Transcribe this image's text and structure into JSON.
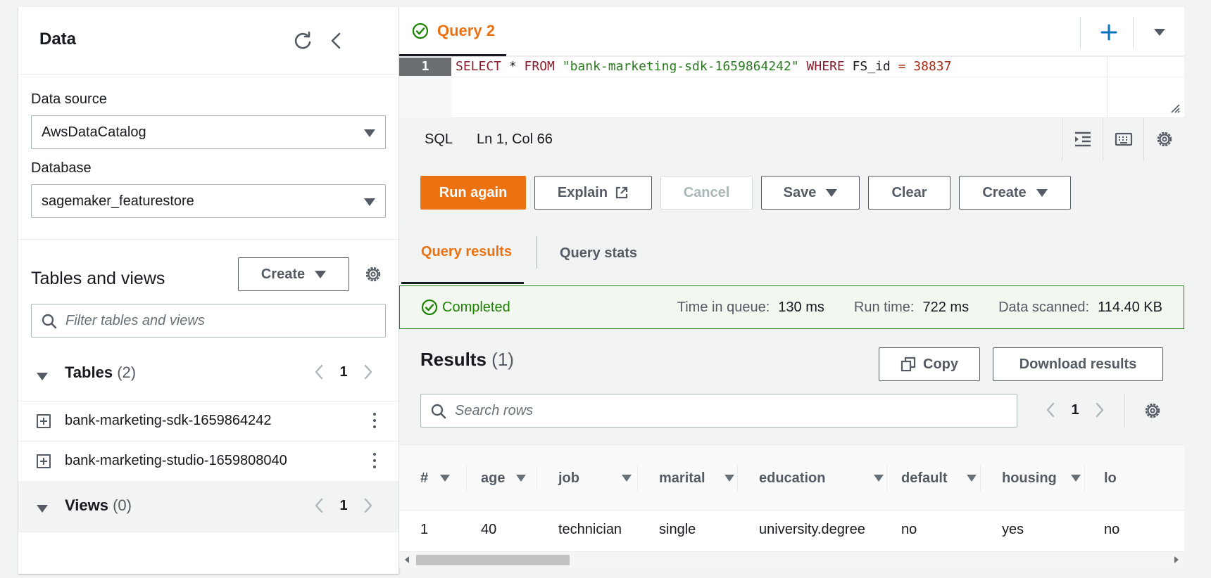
{
  "left_panel": {
    "title": "Data",
    "data_source_label": "Data source",
    "data_source_value": "AwsDataCatalog",
    "database_label": "Database",
    "database_value": "sagemaker_featurestore",
    "tables_views_title": "Tables and views",
    "create_label": "Create",
    "filter_placeholder": "Filter tables and views",
    "tables": {
      "label": "Tables",
      "count": "(2)",
      "page": "1",
      "items": [
        {
          "name": "bank-marketing-sdk-1659864242"
        },
        {
          "name": "bank-marketing-studio-1659808040"
        }
      ]
    },
    "views": {
      "label": "Views",
      "count": "(0)",
      "page": "1"
    }
  },
  "editor": {
    "tab_label": "Query 2",
    "line_number": "1",
    "code_tokens": {
      "t1": "SELECT",
      "t2": " * ",
      "t3": "FROM",
      "t4": " ",
      "t5": "\"bank-marketing-sdk-1659864242\"",
      "t6": " ",
      "t7": "WHERE",
      "t8": " FS_id ",
      "t9": "=",
      "t10": " ",
      "t11": "38837"
    },
    "language": "SQL",
    "cursor_position": "Ln 1, Col 66"
  },
  "actions": {
    "run_again": "Run again",
    "explain": "Explain",
    "cancel": "Cancel",
    "save": "Save",
    "clear": "Clear",
    "create": "Create"
  },
  "result_tabs": {
    "query_results": "Query results",
    "query_stats": "Query stats"
  },
  "status": {
    "state": "Completed",
    "time_in_queue_label": "Time in queue:",
    "time_in_queue": "130 ms",
    "run_time_label": "Run time:",
    "run_time": "722 ms",
    "data_scanned_label": "Data scanned:",
    "data_scanned": "114.40 KB"
  },
  "results": {
    "title": "Results",
    "count": "(1)",
    "copy": "Copy",
    "download": "Download results",
    "search_placeholder": "Search rows",
    "page": "1",
    "columns": [
      "#",
      "age",
      "job",
      "marital",
      "education",
      "default",
      "housing",
      "lo"
    ],
    "rows": [
      [
        "1",
        "40",
        "technician",
        "single",
        "university.degree",
        "no",
        "yes",
        "no"
      ]
    ]
  },
  "colors": {
    "accent": "#ec7211",
    "success": "#1d8102",
    "link_blue": "#0073bb"
  }
}
